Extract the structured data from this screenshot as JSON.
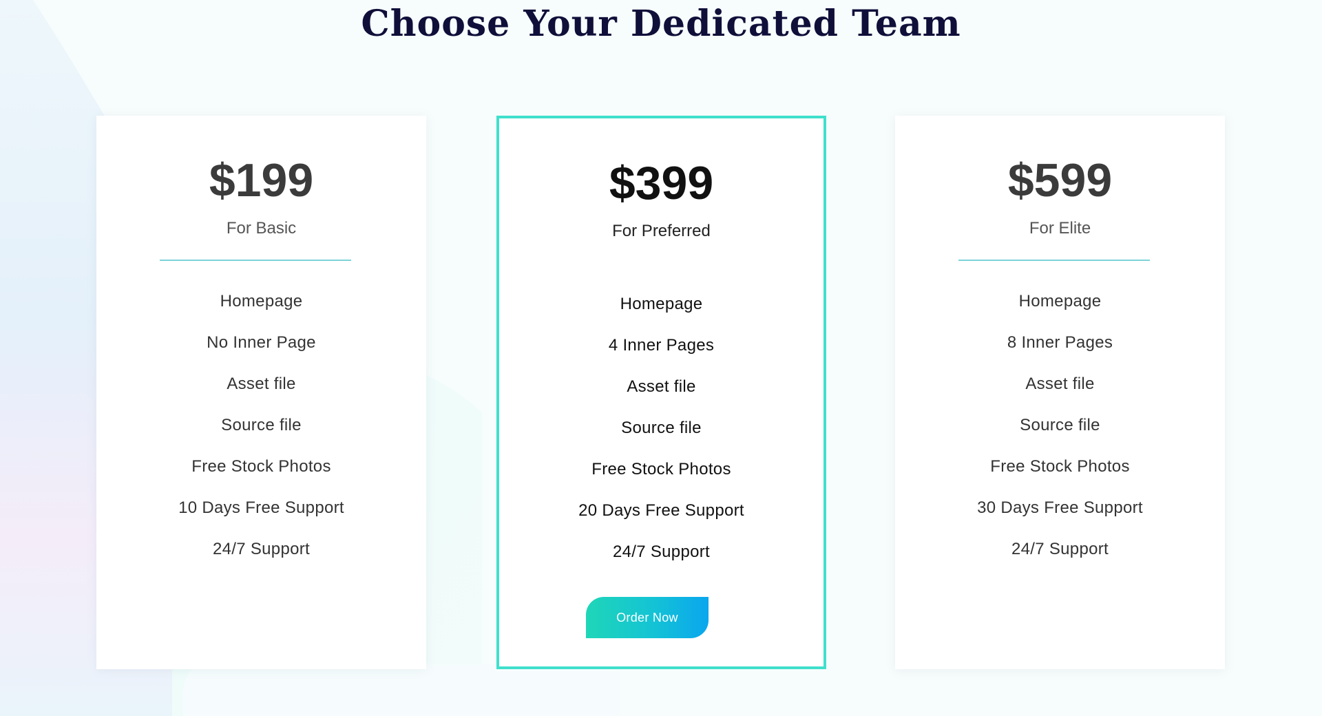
{
  "section": {
    "title": "Choose Your Dedicated Team"
  },
  "plans": [
    {
      "price": "$199",
      "name": "For Basic",
      "features": [
        "Homepage",
        "No Inner Page",
        "Asset file",
        "Source file",
        "Free Stock Photos",
        "10 Days Free Support",
        "24/7 Support"
      ]
    },
    {
      "price": "$399",
      "name": "For Preferred",
      "features": [
        "Homepage",
        "4 Inner Pages",
        "Asset file",
        "Source file",
        "Free Stock Photos",
        "20 Days Free Support",
        "24/7 Support"
      ],
      "button_label": "Order Now"
    },
    {
      "price": "$599",
      "name": "For Elite",
      "features": [
        "Homepage",
        "8 Inner Pages",
        "Asset file",
        "Source file",
        "Free Stock Photos",
        "30 Days Free Support",
        "24/7 Support"
      ]
    }
  ],
  "colors": {
    "accent_border": "#3fe0cc",
    "divider": "#7cd3d8",
    "button_gradient_start": "#1fd6b7",
    "button_gradient_end": "#0aa6ee",
    "title": "#0f0f3a"
  }
}
